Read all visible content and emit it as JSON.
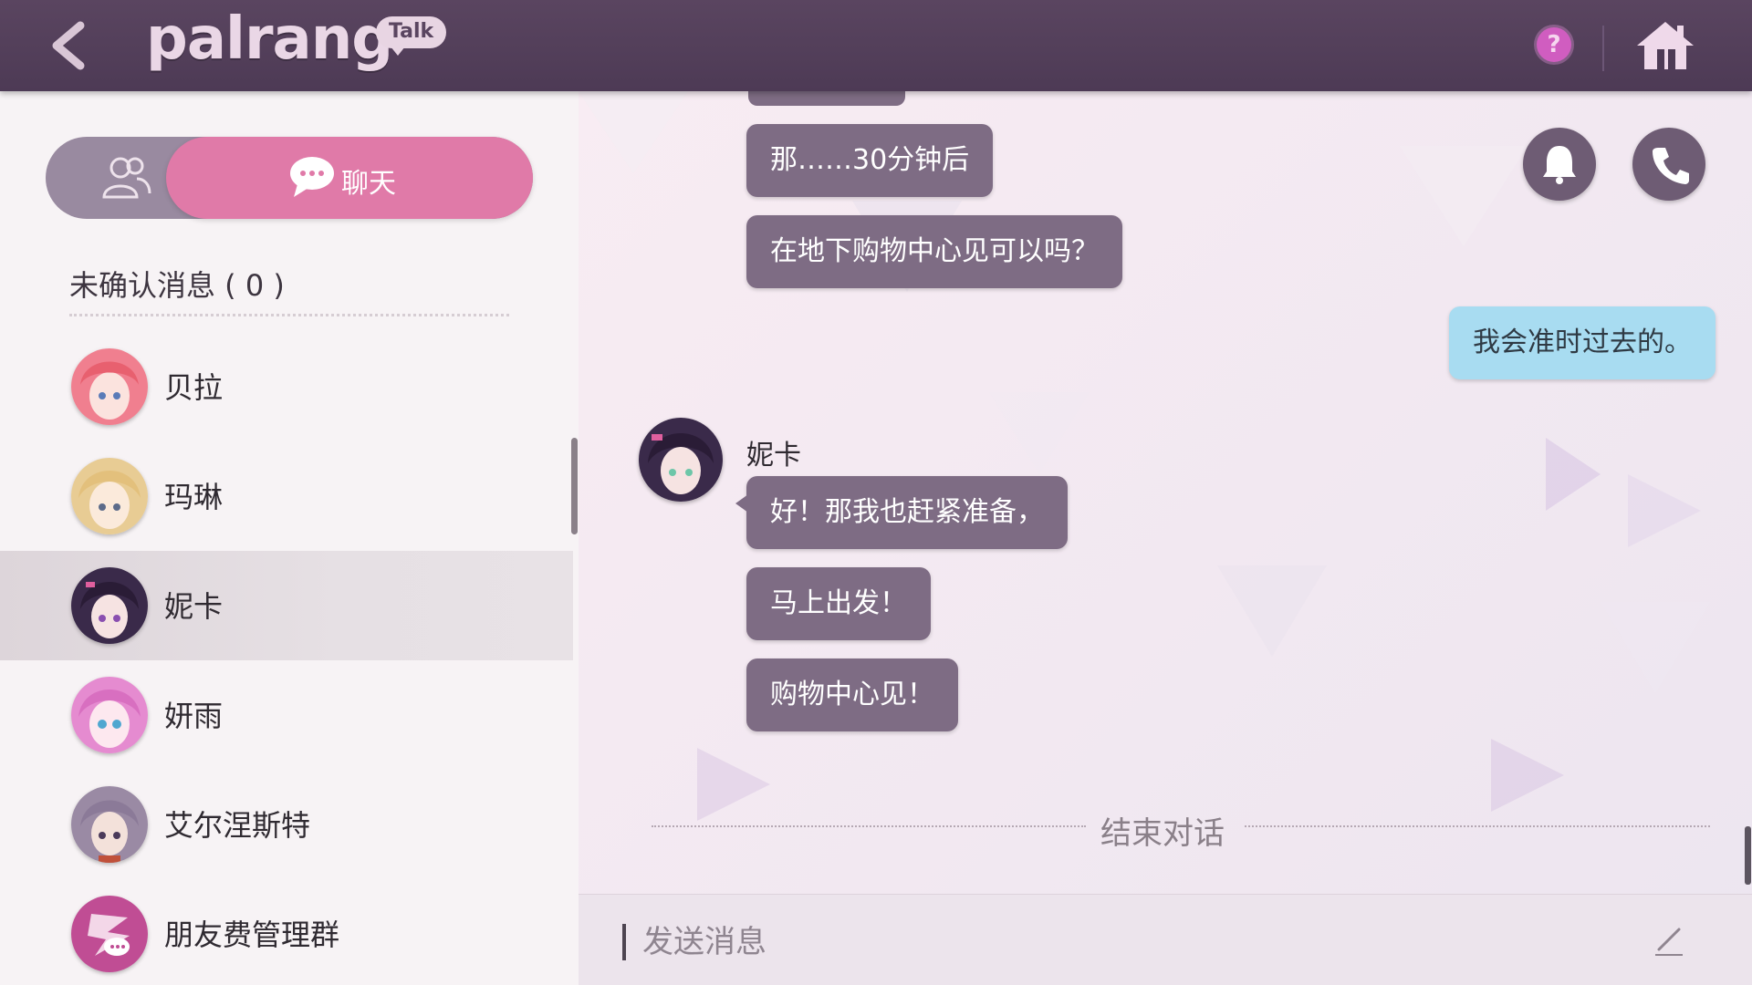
{
  "header": {
    "logo_text": "palrang",
    "logo_badge": "Talk",
    "help_label": "?"
  },
  "tabs": {
    "chat_label": "聊天"
  },
  "sidebar": {
    "unread_title": "未确认消息 ( 0 )",
    "contacts": [
      {
        "name": "贝拉",
        "avatar_color": "#f07f8f",
        "selected": false
      },
      {
        "name": "玛琳",
        "avatar_color": "#e8cc94",
        "selected": false
      },
      {
        "name": "妮卡",
        "avatar_color": "#3a2a4a",
        "selected": true
      },
      {
        "name": "妍雨",
        "avatar_color": "#e58bd0",
        "selected": false
      },
      {
        "name": "艾尔涅斯特",
        "avatar_color": "#9a8aa4",
        "selected": false
      },
      {
        "name": "朋友费管理群",
        "avatar_color": "#c04d94",
        "selected": false
      }
    ]
  },
  "chat": {
    "messages": [
      {
        "text": "那……30分钟后",
        "from": "other"
      },
      {
        "text": "在地下购物中心见可以吗？",
        "from": "other"
      },
      {
        "text": "我会准时过去的。",
        "from": "me"
      },
      {
        "text": "好！那我也赶紧准备，",
        "from": "other"
      },
      {
        "text": "马上出发！",
        "from": "other"
      },
      {
        "text": "购物中心见！",
        "from": "other"
      }
    ],
    "sender_name": "妮卡",
    "end_label": "结束对话"
  },
  "input": {
    "placeholder": "发送消息"
  },
  "colors": {
    "topbar": "#4d3a55",
    "chat_tab": "#e07aa8",
    "bubble_other": "#7e6c84",
    "bubble_me": "#a8dcf1",
    "help": "#d05dc0"
  }
}
